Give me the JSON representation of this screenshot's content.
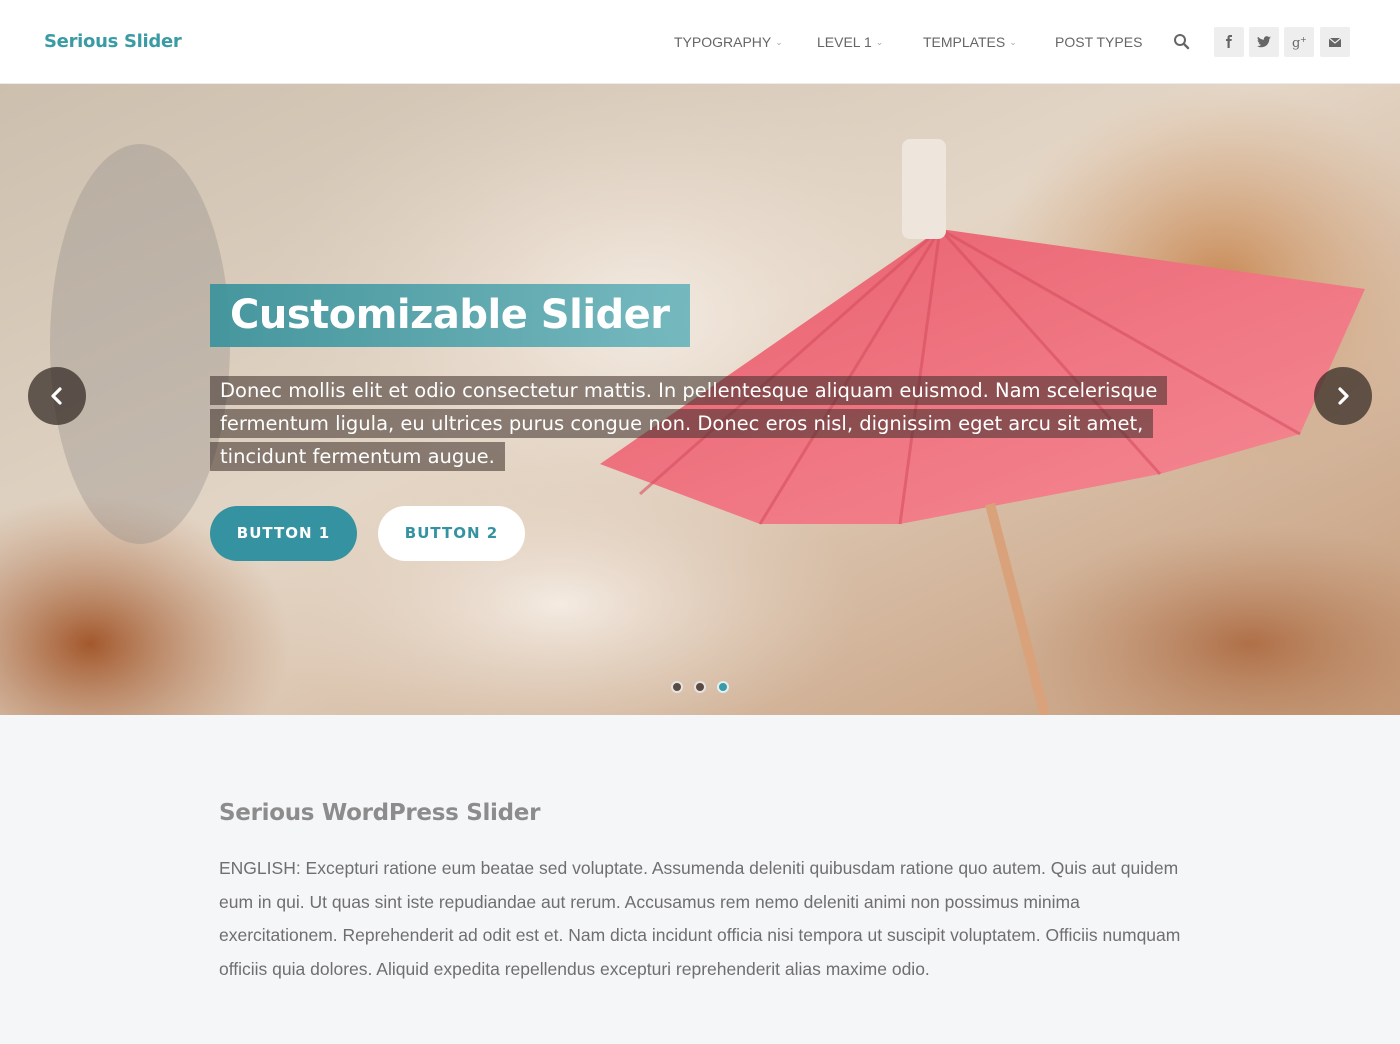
{
  "header": {
    "logo": "Serious Slider",
    "nav": [
      {
        "label": "TYPOGRAPHY",
        "has_dropdown": true
      },
      {
        "label": "LEVEL 1",
        "has_dropdown": true
      },
      {
        "label": "TEMPLATES",
        "has_dropdown": true
      },
      {
        "label": "POST TYPES",
        "has_dropdown": false
      }
    ],
    "icons": [
      "search-icon",
      "facebook-icon",
      "twitter-icon",
      "google-plus-icon",
      "email-icon"
    ]
  },
  "slider": {
    "title": "Customizable Slider",
    "text": "Donec mollis elit et odio consectetur mattis. In pellentesque aliquam euismod. Nam scelerisque fermentum ligula, eu ultrices purus congue non. Donec eros nisl, dignissim eget arcu sit amet, tincidunt fermentum augue.",
    "button1": "BUTTON 1",
    "button2": "BUTTON 2",
    "slide_count": 3,
    "active_slide": 3
  },
  "content": {
    "heading": "Serious WordPress Slider",
    "body": "ENGLISH: Excepturi ratione eum beatae sed voluptate. Assumenda deleniti quibusdam ratione quo autem. Quis aut quidem eum in qui. Ut quas sint iste repudiandae aut rerum. Accusamus rem nemo deleniti animi non possimus minima exercitationem. Reprehenderit ad odit est et. Nam dicta incidunt officia nisi tempora ut suscipit voluptatem. Officiis numquam officiis quia dolores. Aliquid expedita repellendus excepturi reprehenderit alias maxime odio."
  },
  "colors": {
    "accent": "#3592a0",
    "background": "#f5f6f8"
  }
}
